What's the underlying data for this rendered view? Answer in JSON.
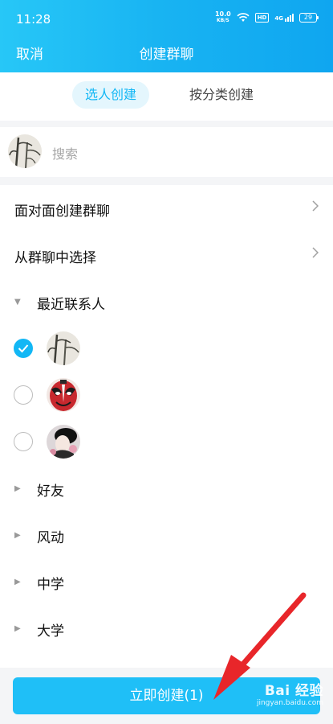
{
  "status_bar": {
    "time": "11:28",
    "net_speed_value": "10.0",
    "net_speed_unit": "KB/S",
    "hd": "HD",
    "signal": "4G",
    "battery": "29"
  },
  "header": {
    "cancel_label": "取消",
    "title": "创建群聊"
  },
  "tabs": [
    {
      "label": "选人创建",
      "active": true
    },
    {
      "label": "按分类创建",
      "active": false
    }
  ],
  "search": {
    "placeholder": "搜索"
  },
  "options": [
    {
      "label": "面对面创建群聊"
    },
    {
      "label": "从群聊中选择"
    }
  ],
  "recent": {
    "label": "最近联系人",
    "contacts": [
      {
        "selected": true
      },
      {
        "selected": false
      },
      {
        "selected": false
      }
    ]
  },
  "groups": [
    {
      "label": "好友"
    },
    {
      "label": "风动"
    },
    {
      "label": "中学"
    },
    {
      "label": "大学"
    }
  ],
  "create_button": {
    "label": "立即创建(1)"
  },
  "watermark": {
    "text": "Bai 经验",
    "url": "jingyan.baidu.com"
  },
  "colors": {
    "accent": "#12b7f5",
    "header_gradient_start": "#27c7f7",
    "arrow": "#e8262a"
  }
}
